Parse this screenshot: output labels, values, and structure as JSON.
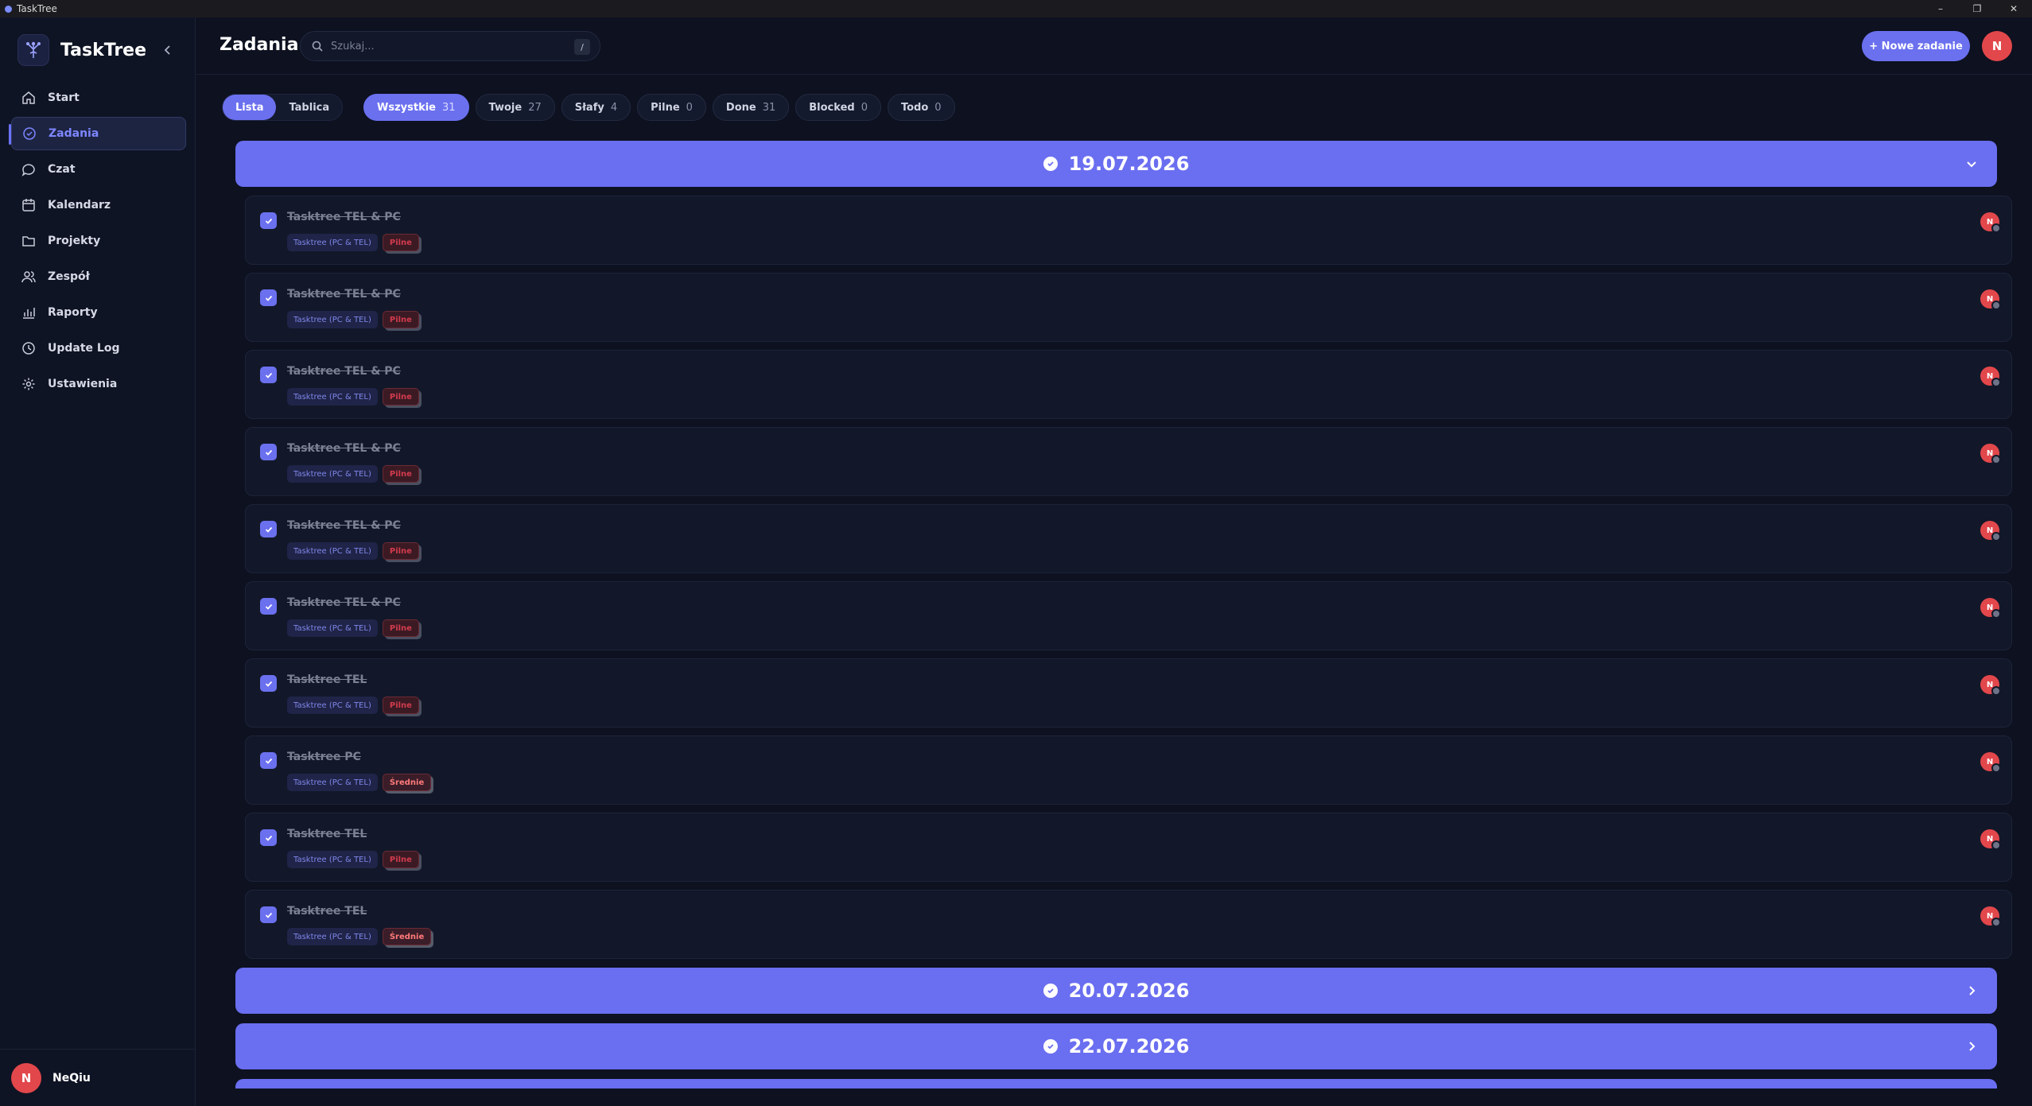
{
  "window": {
    "title": "TaskTree",
    "controls": [
      "–",
      "❐",
      "✕"
    ]
  },
  "sidebar": {
    "brand": "TaskTree",
    "items": [
      {
        "label": "Start",
        "icon": "home-icon",
        "active": false
      },
      {
        "label": "Zadania",
        "icon": "check-circle-icon",
        "active": true
      },
      {
        "label": "Czat",
        "icon": "chat-icon",
        "active": false
      },
      {
        "label": "Kalendarz",
        "icon": "calendar-icon",
        "active": false
      },
      {
        "label": "Projekty",
        "icon": "folder-icon",
        "active": false
      },
      {
        "label": "Zespół",
        "icon": "team-icon",
        "active": false
      },
      {
        "label": "Raporty",
        "icon": "chart-icon",
        "active": false
      },
      {
        "label": "Update Log",
        "icon": "clock-icon",
        "active": false
      },
      {
        "label": "Ustawienia",
        "icon": "gear-icon",
        "active": false
      }
    ],
    "user": {
      "initial": "N",
      "name": "NeQiu"
    }
  },
  "header": {
    "title": "Zadania",
    "search": {
      "placeholder": "Szukaj...",
      "shortcut": "/"
    },
    "new_task_label": "+ Nowe zadanie",
    "avatar_initial": "N"
  },
  "view_toggle": [
    {
      "label": "Lista",
      "active": true
    },
    {
      "label": "Tablica",
      "active": false
    }
  ],
  "filters": [
    {
      "label": "Wszystkie",
      "count": "31",
      "active": true
    },
    {
      "label": "Twoje",
      "count": "27",
      "active": false
    },
    {
      "label": "Słafy",
      "count": "4",
      "active": false
    },
    {
      "label": "Pilne",
      "count": "0",
      "active": false
    },
    {
      "label": "Done",
      "count": "31",
      "active": false
    },
    {
      "label": "Blocked",
      "count": "0",
      "active": false
    },
    {
      "label": "Todo",
      "count": "0",
      "active": false
    }
  ],
  "groups": [
    {
      "date": "19.07.2026",
      "expanded": true
    },
    {
      "date": "20.07.2026",
      "expanded": false
    },
    {
      "date": "22.07.2026",
      "expanded": false
    }
  ],
  "tasks": [
    {
      "title": "Tasktree TEL & PC",
      "project": "Tasktree (PC & TEL)",
      "priority": "Pilne",
      "priority_kind": "urgent",
      "assignee": "N"
    },
    {
      "title": "Tasktree TEL & PC",
      "project": "Tasktree (PC & TEL)",
      "priority": "Pilne",
      "priority_kind": "urgent",
      "assignee": "N"
    },
    {
      "title": "Tasktree TEL & PC",
      "project": "Tasktree (PC & TEL)",
      "priority": "Pilne",
      "priority_kind": "urgent",
      "assignee": "N"
    },
    {
      "title": "Tasktree TEL & PC",
      "project": "Tasktree (PC & TEL)",
      "priority": "Pilne",
      "priority_kind": "urgent",
      "assignee": "N"
    },
    {
      "title": "Tasktree TEL & PC",
      "project": "Tasktree (PC & TEL)",
      "priority": "Pilne",
      "priority_kind": "urgent",
      "assignee": "N"
    },
    {
      "title": "Tasktree TEL & PC",
      "project": "Tasktree (PC & TEL)",
      "priority": "Pilne",
      "priority_kind": "urgent",
      "assignee": "N"
    },
    {
      "title": "Tasktree TEL",
      "project": "Tasktree (PC & TEL)",
      "priority": "Pilne",
      "priority_kind": "urgent",
      "assignee": "N"
    },
    {
      "title": "Tasktree PC",
      "project": "Tasktree (PC & TEL)",
      "priority": "Średnie",
      "priority_kind": "medium",
      "assignee": "N"
    },
    {
      "title": "Tasktree TEL",
      "project": "Tasktree (PC & TEL)",
      "priority": "Pilne",
      "priority_kind": "urgent",
      "assignee": "N"
    },
    {
      "title": "Tasktree TEL",
      "project": "Tasktree (PC & TEL)",
      "priority": "Średnie",
      "priority_kind": "medium",
      "assignee": "N"
    }
  ],
  "colors": {
    "accent": "#6b70ef",
    "background": "#0d1120",
    "avatar": "#e2474b",
    "urgent": "#d13b4d"
  }
}
